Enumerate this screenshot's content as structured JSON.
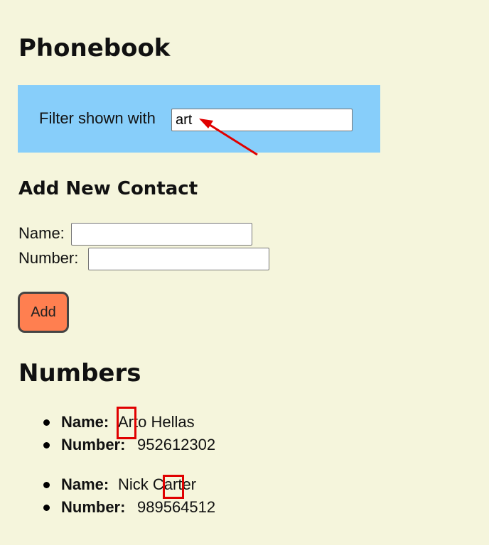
{
  "page": {
    "title": "Phonebook"
  },
  "filter": {
    "label": "Filter shown with",
    "value": "art"
  },
  "add_contact": {
    "heading": "Add New Contact",
    "name_label": "Name:",
    "number_label": "Number:",
    "add_button_label": "Add"
  },
  "numbers": {
    "heading": "Numbers",
    "entries": [
      {
        "name_label": "Name:",
        "name": "Arto Hellas",
        "number_label": "Number:",
        "number": "952612302"
      },
      {
        "name_label": "Name:",
        "name": "Nick Carter",
        "number_label": "Number:",
        "number": "989564512"
      }
    ]
  },
  "colors": {
    "background": "#f5f5dc",
    "filter_box": "#87cefa",
    "add_button": "#ff7f50",
    "annotation": "#e00000"
  },
  "annotations": {
    "arrow_icon": "arrow-pointing-to-filter-input",
    "highlight_boxes": [
      "highlight-art-in-arto",
      "highlight-ar-in-carter"
    ]
  }
}
